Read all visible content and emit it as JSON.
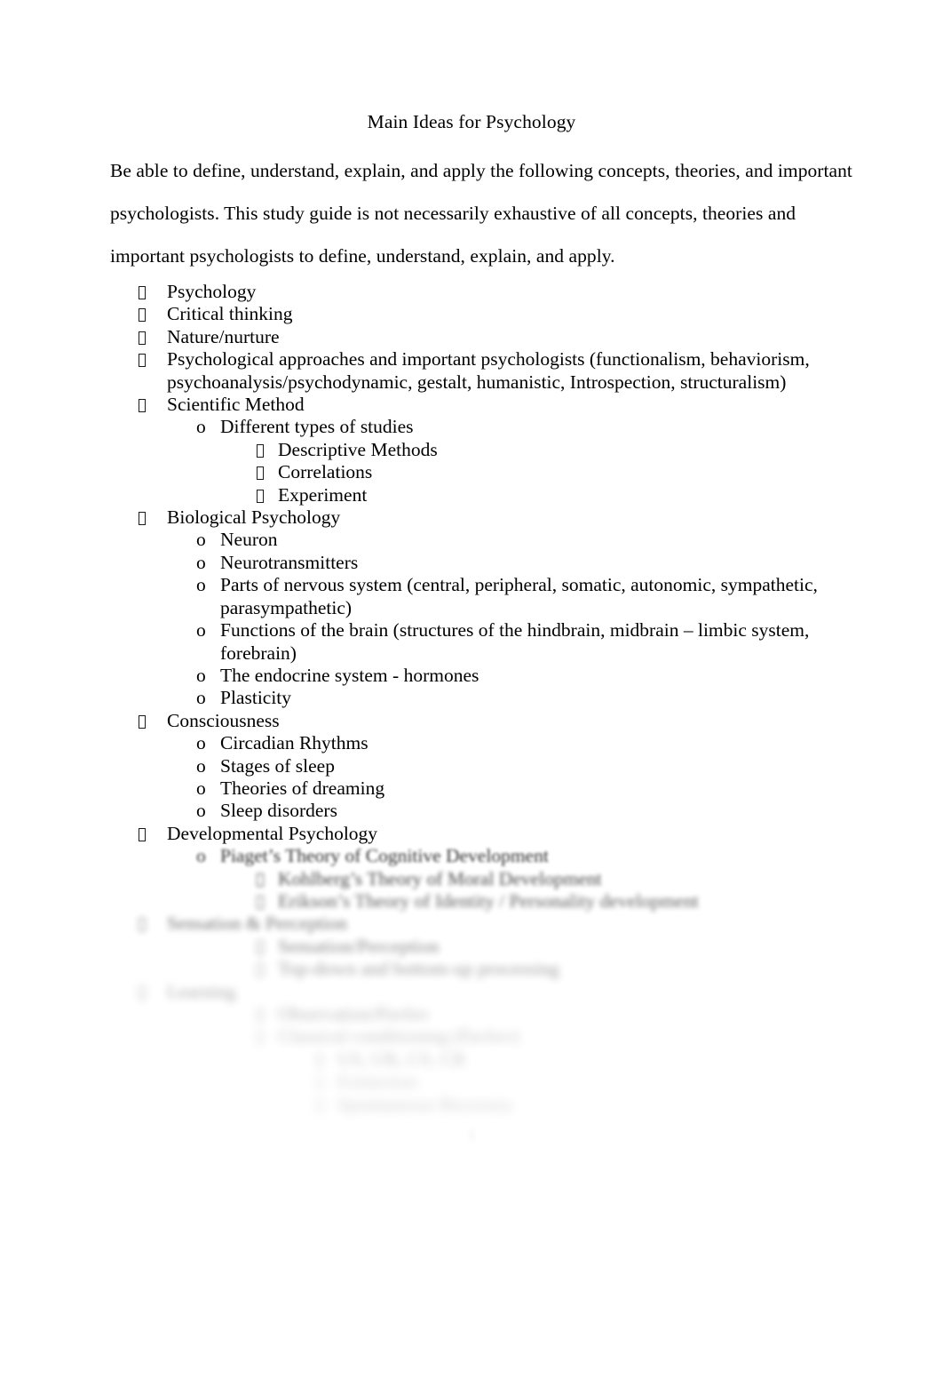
{
  "document": {
    "title": "Main Ideas for Psychology",
    "page_number": "1"
  },
  "intro": {
    "line1": "Be able to define, understand, explain, and apply the following concepts, theories, and important",
    "line2": "psychologists. This study guide is not necessarily exhaustive of all concepts, theories and",
    "line3": "important psychologists to define, understand, explain, and apply."
  },
  "bullets": {
    "level1_glyph": "missing-glyph-box",
    "level2_glyph": "o",
    "level3_glyph": "missing-glyph-box",
    "level4_glyph": "missing-glyph-box"
  },
  "outline": [
    {
      "level": 1,
      "text": "Psychology"
    },
    {
      "level": 1,
      "text": "Critical thinking"
    },
    {
      "level": 1,
      "text": "Nature/nurture"
    },
    {
      "level": 1,
      "text": "Psychological approaches and important psychologists (functionalism, behaviorism, psychoanalysis/psychodynamic, gestalt, humanistic, Introspection, structuralism)"
    },
    {
      "level": 1,
      "text": "Scientific Method"
    },
    {
      "level": 2,
      "text": "Different types of studies"
    },
    {
      "level": 3,
      "text": "Descriptive Methods"
    },
    {
      "level": 3,
      "text": "Correlations"
    },
    {
      "level": 3,
      "text": "Experiment"
    },
    {
      "level": 1,
      "text": "Biological Psychology"
    },
    {
      "level": 2,
      "text": "Neuron"
    },
    {
      "level": 2,
      "text": "Neurotransmitters"
    },
    {
      "level": 2,
      "text": "Parts of nervous system (central, peripheral, somatic, autonomic, sympathetic, parasympathetic)"
    },
    {
      "level": 2,
      "text": "Functions of the brain (structures of the hindbrain, midbrain – limbic system, forebrain)"
    },
    {
      "level": 2,
      "text": "The endocrine system - hormones"
    },
    {
      "level": 2,
      "text": "Plasticity"
    },
    {
      "level": 1,
      "text": "Consciousness"
    },
    {
      "level": 2,
      "text": "Circadian Rhythms"
    },
    {
      "level": 2,
      "text": "Stages of sleep"
    },
    {
      "level": 2,
      "text": "Theories of dreaming"
    },
    {
      "level": 2,
      "text": "Sleep disorders"
    },
    {
      "level": 1,
      "text": "Developmental Psychology"
    }
  ],
  "outline_obscured": [
    {
      "level": 2,
      "blur": 1,
      "text": "Piaget’s Theory of Cognitive Development"
    },
    {
      "level": 3,
      "blur": 2,
      "text": "Kohlberg’s Theory of Moral Development"
    },
    {
      "level": 3,
      "blur": 3,
      "text": "Erikson’s Theory of Identity / Personality development"
    },
    {
      "level": 1,
      "blur": 4,
      "text": "Sensation & Perception"
    },
    {
      "level": 3,
      "blur": 5,
      "text": "Sensation/Perception"
    },
    {
      "level": 3,
      "blur": 6,
      "text": "Top-down and bottom-up processing"
    },
    {
      "level": 1,
      "blur": 7,
      "text": "Learning"
    },
    {
      "level": 3,
      "blur": 8,
      "text": "Observation/Pavlov"
    },
    {
      "level": 3,
      "blur": 9,
      "text": "Classical conditioning (Pavlov)"
    },
    {
      "level": 4,
      "blur": 9,
      "text": "US, UR, CS, CR"
    },
    {
      "level": 4,
      "blur": 10,
      "text": "Extinction"
    },
    {
      "level": 4,
      "blur": 10,
      "text": "Spontaneous Recovery"
    }
  ]
}
